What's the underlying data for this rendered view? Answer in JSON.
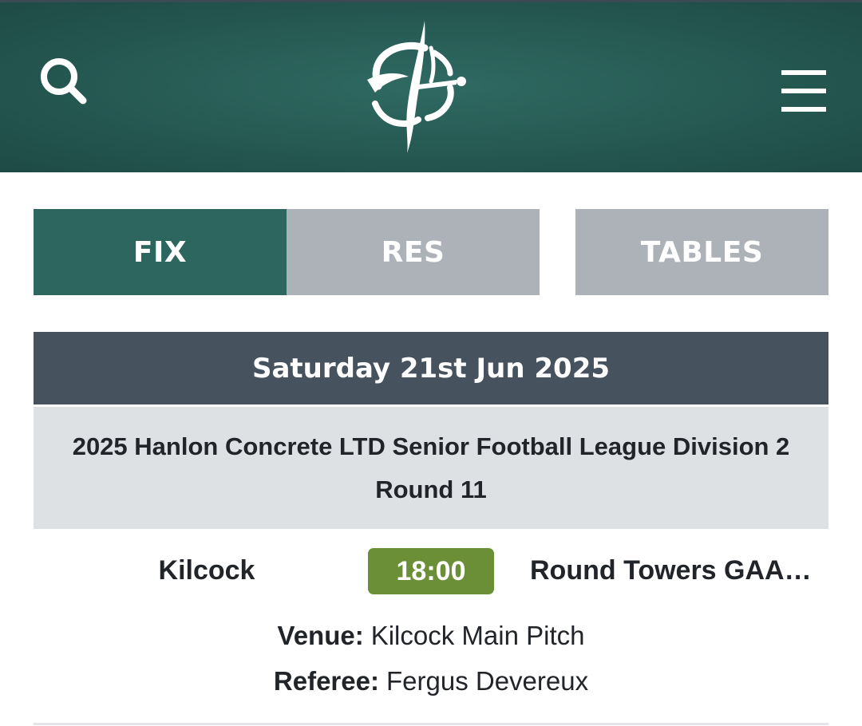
{
  "header": {
    "search_icon": "search-icon",
    "logo_icon": "gaa-logo-icon",
    "menu_icon": "hamburger-menu-icon",
    "background_color": "#2c665e"
  },
  "tabs": {
    "fixtures_label": "FIX",
    "results_label": "RES",
    "tables_label": "TABLES",
    "active_color": "#2c665e",
    "inactive_color": "#adb1b8"
  },
  "fixture_group": {
    "date": "Saturday 21st Jun 2025",
    "competition_line1": "2025 Hanlon Concrete LTD Senior Football League Division 2",
    "competition_line2": "Round 11"
  },
  "fixture": {
    "home_team": "Kilcock",
    "time": "18:00",
    "away_team": "Round Towers GAA…",
    "venue_label": "Venue:",
    "venue": "Kilcock Main Pitch",
    "referee_label": "Referee:",
    "referee": "Fergus Devereux",
    "time_badge_color": "#6b8f36"
  }
}
